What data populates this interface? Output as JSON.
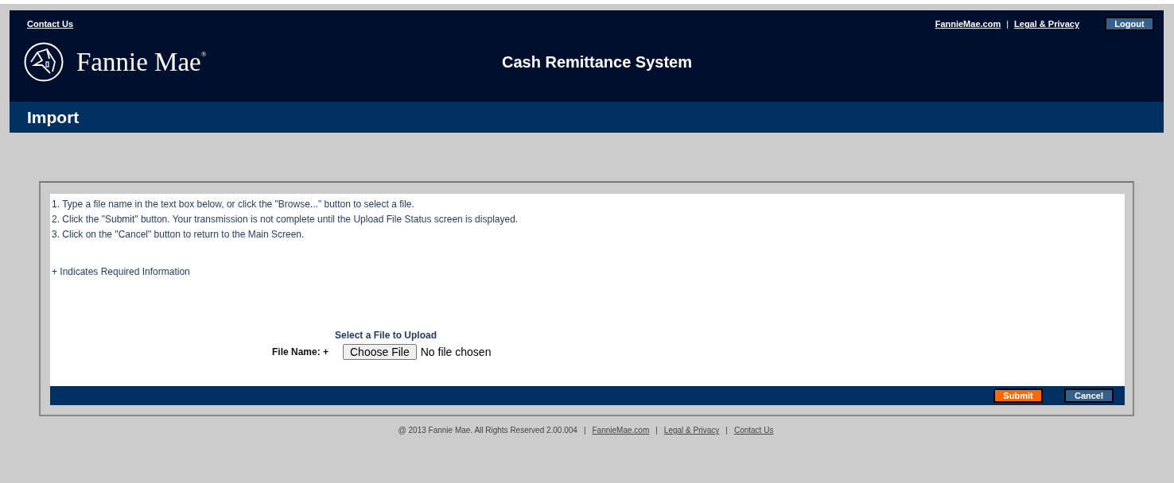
{
  "header": {
    "contact_link": "Contact Us",
    "links": [
      "FannieMae.com",
      "Legal & Privacy"
    ],
    "separator": "|",
    "logout_button": "Logout",
    "brand": "Fannie Mae",
    "brand_mark": "®",
    "system_title": "Cash Remittance System"
  },
  "page_title": "Import",
  "instructions": [
    "1. Type a file name in the text box below, or click the \"Browse...\" button to select a file.",
    "2. Click the \"Submit\" button. Your transmission is not complete until the Upload File Status screen is displayed.",
    "3. Click on the \"Cancel\" button to return to the Main Screen."
  ],
  "required_note": "+ Indicates Required Information",
  "upload": {
    "heading": "Select a File to Upload",
    "label": "File Name: +",
    "choose_button": "Choose File",
    "file_status": "No file chosen"
  },
  "actions": {
    "submit": "Submit",
    "cancel": "Cancel"
  },
  "footer": {
    "copyright": "@ 2013 Fannie Mae. All Rights Reserved 2.00.004",
    "separator": "|",
    "links": [
      "FannieMae.com",
      "Legal & Privacy",
      "Contact Us"
    ]
  }
}
